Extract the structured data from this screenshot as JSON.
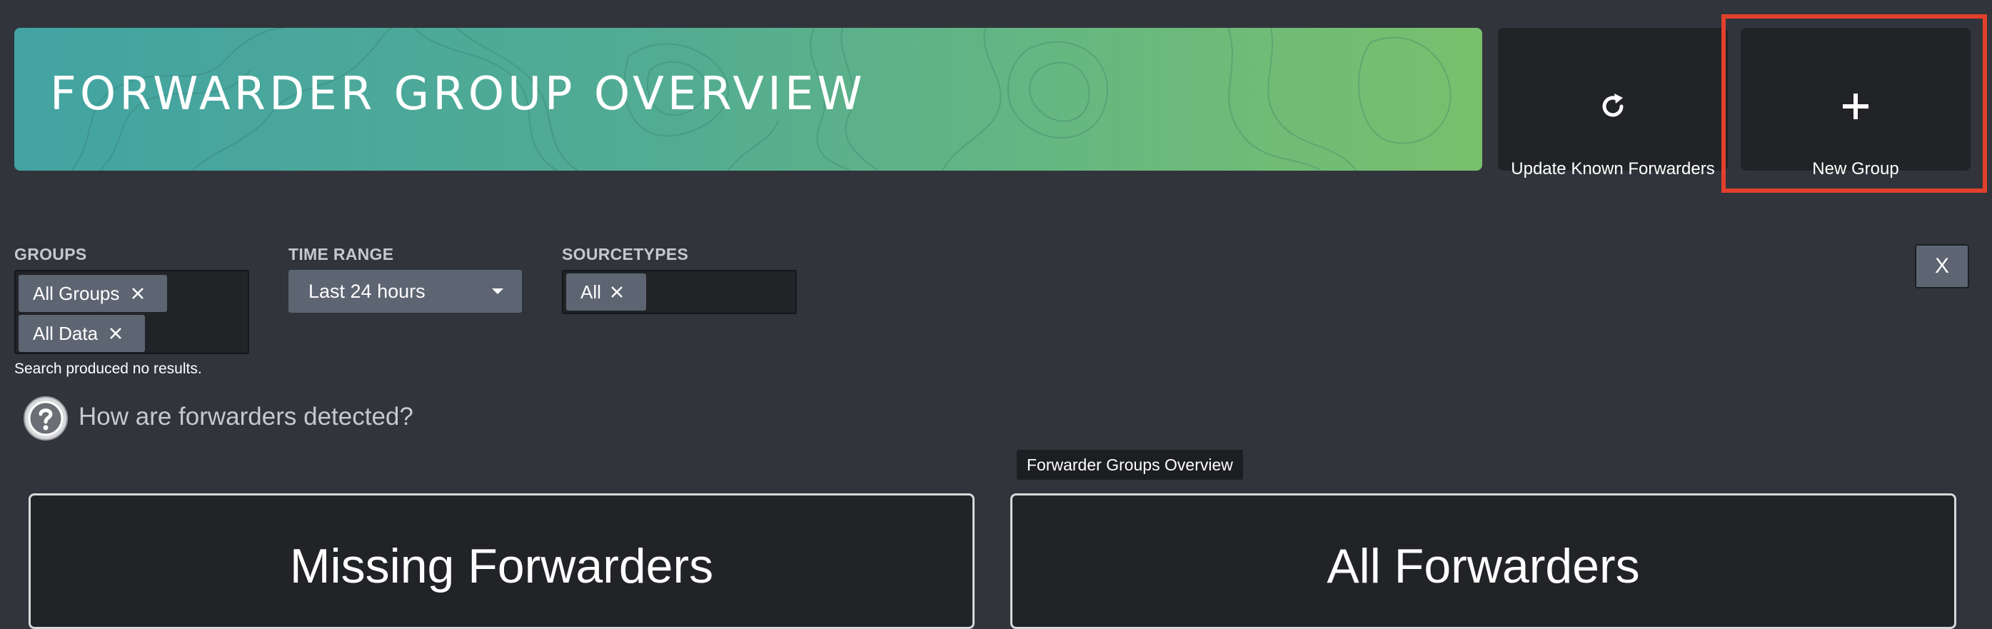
{
  "banner": {
    "title": "FORWARDER GROUP OVERVIEW"
  },
  "actions": {
    "update_forwarders": {
      "label": "Update Known Forwarders",
      "icon": "refresh-icon"
    },
    "new_group": {
      "label": "New Group",
      "icon": "plus-icon",
      "highlighted": true
    }
  },
  "filters": {
    "groups": {
      "label": "GROUPS",
      "chips": [
        {
          "label": "All Groups"
        },
        {
          "label": "All Data"
        }
      ]
    },
    "time_range": {
      "label": "TIME RANGE",
      "value": "Last 24 hours"
    },
    "sourcetypes": {
      "label": "SOURCETYPES",
      "chips": [
        {
          "label": "All"
        }
      ]
    },
    "clear_label": "X"
  },
  "status": {
    "no_results": "Search produced no results."
  },
  "help": {
    "text": "How are forwarders detected?",
    "icon": "question-circle-icon"
  },
  "tooltip": {
    "text": "Forwarder Groups Overview"
  },
  "panels": {
    "missing": {
      "title": "Missing Forwarders"
    },
    "all": {
      "title": "All Forwarders"
    }
  },
  "colors": {
    "background": "#31343b",
    "panel": "#212327",
    "chip": "#5d6572",
    "banner_start": "#42a3a2",
    "banner_end": "#78c06d",
    "highlight": "#e2402c"
  }
}
